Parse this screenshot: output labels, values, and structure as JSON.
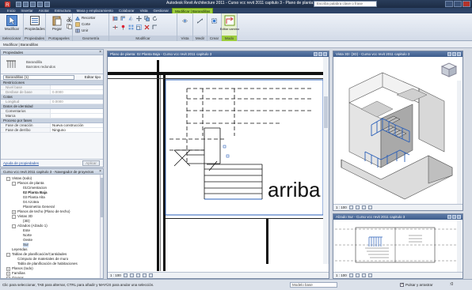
{
  "titlebar": {
    "title": "Autodesk Revit Architecture 2011 - Curso vcc revit 2011 capitulo 3 - Plano de planta: 02 Planta Baja",
    "search_placeholder": "Escriba palabra clave o frase"
  },
  "tabs": [
    "Inicio",
    "Insertar",
    "Anotar",
    "Estructura",
    "Masa y emplazamiento",
    "Colaborar",
    "Vista",
    "Gestionar",
    "Modificar | Barandillas"
  ],
  "active_tab_index": 8,
  "ribbon": {
    "panels": [
      {
        "label": "Seleccionar",
        "button": "Modificar"
      },
      {
        "label": "Propiedades",
        "button": "Propiedades"
      },
      {
        "label": "Portapapeles",
        "button": "Pegar"
      },
      {
        "label": "Geometría",
        "rows": [
          "Recortar",
          "Corte",
          "Unir"
        ]
      },
      {
        "label": "Modificar"
      },
      {
        "label": "Vista"
      },
      {
        "label": "Medir"
      },
      {
        "label": "Crear"
      },
      {
        "label": "Modo",
        "button": "Editar camino"
      }
    ]
  },
  "options_bar": "Modificar | Barandillas",
  "properties": {
    "header": "Propiedades",
    "type_name": "Barandilla",
    "type_sub": "Barrotes redondos",
    "selector": "Barandillas (1)",
    "edit_type": "Editar tipo",
    "sections": [
      {
        "name": "Restricciones",
        "rows": [
          [
            "Nivel base",
            "",
            true
          ],
          [
            "Desfase de base",
            "0.0000",
            true
          ]
        ]
      },
      {
        "name": "Cotas",
        "rows": [
          [
            "Longitud",
            "0.0000",
            true
          ]
        ]
      },
      {
        "name": "Datos de identidad",
        "rows": [
          [
            "Comentarios",
            "",
            false
          ],
          [
            "Marca",
            "",
            false
          ]
        ]
      },
      {
        "name": "Proceso por fases",
        "rows": [
          [
            "Fase de creación",
            "Nueva construcción",
            false
          ],
          [
            "Fase de derribo",
            "Ninguno",
            false
          ]
        ]
      }
    ],
    "help": "Ayuda de propiedades",
    "apply": "Aplicar"
  },
  "browser": {
    "header": "Curso vcc revit 2011 capitulo 3 - Navegador de proyectos",
    "nodes": [
      {
        "indent": 1,
        "toggle": "-",
        "text": "Vistas (todo)",
        "bold": false
      },
      {
        "indent": 2,
        "toggle": "-",
        "text": "Planos de planta",
        "bold": false
      },
      {
        "indent": 3,
        "toggle": "",
        "text": "01Cimentacion",
        "bold": false
      },
      {
        "indent": 3,
        "toggle": "",
        "text": "02 Planta Baja",
        "bold": true
      },
      {
        "indent": 3,
        "toggle": "",
        "text": "03 Planta Alta",
        "bold": false
      },
      {
        "indent": 3,
        "toggle": "",
        "text": "04 Azotea",
        "bold": false
      },
      {
        "indent": 3,
        "toggle": "",
        "text": "Planimetria General",
        "bold": false
      },
      {
        "indent": 2,
        "toggle": "+",
        "text": "Planos de techo (Plano de techo)",
        "bold": false
      },
      {
        "indent": 2,
        "toggle": "-",
        "text": "Vistas 3D",
        "bold": false
      },
      {
        "indent": 3,
        "toggle": "",
        "text": "{3D}",
        "bold": false
      },
      {
        "indent": 2,
        "toggle": "-",
        "text": "Alzados (Alzado 1)",
        "bold": false
      },
      {
        "indent": 3,
        "toggle": "",
        "text": "Este",
        "bold": false
      },
      {
        "indent": 3,
        "toggle": "",
        "text": "Norte",
        "bold": false
      },
      {
        "indent": 3,
        "toggle": "",
        "text": "Oeste",
        "bold": false
      },
      {
        "indent": 3,
        "toggle": "",
        "text": "Sur",
        "bold": false,
        "selected": true
      },
      {
        "indent": 1,
        "toggle": "",
        "text": "Leyendas",
        "bold": false
      },
      {
        "indent": 1,
        "toggle": "-",
        "text": "Tablas de planificación/Cantidades",
        "bold": false
      },
      {
        "indent": 2,
        "toggle": "",
        "text": "Cómputo de materiales de muro",
        "bold": false
      },
      {
        "indent": 2,
        "toggle": "",
        "text": "Tabla de planificación de habitaciones",
        "bold": false
      },
      {
        "indent": 1,
        "toggle": "+",
        "text": "Planos (todo)",
        "bold": false
      },
      {
        "indent": 1,
        "toggle": "+",
        "text": "Familias",
        "bold": false
      },
      {
        "indent": 1,
        "toggle": "+",
        "text": "Grupos",
        "bold": false
      }
    ]
  },
  "views": {
    "plan_title": "Plano de planta: 02 Planta Baja - Curso vcc revit 2011 capitulo 3",
    "plan_scale": "1 : 100",
    "plan_text": "arriba",
    "view3d_title": "Vista 3D: {3D} - Curso vcc revit 2011 capitulo 3",
    "view3d_scale": "1 : 100",
    "elev_title": "Alzado Sur - Curso vcc revit 2011 capitulo 3",
    "elev_scale": "1 : 100"
  },
  "status": {
    "message": "Clic para seleccionar, TAB para alternar, CTRL para añadir y MAYÚS para anular una selección.",
    "model": "Modelo base",
    "press_drag": "Pulsar y arrastrar",
    "filter_count": ":0"
  },
  "colors": {
    "accent": "#9ccd3c",
    "selection": "#2a5fb8"
  }
}
